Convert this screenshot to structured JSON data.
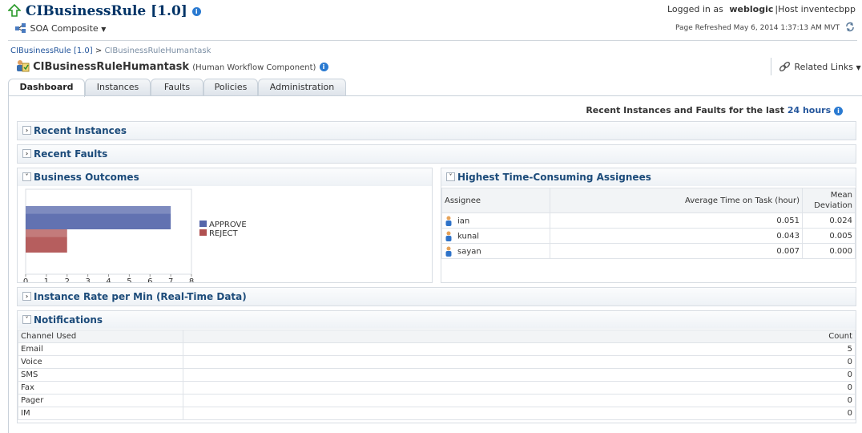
{
  "header": {
    "title": "CIBusinessRule [1.0]",
    "menu": "SOA Composite",
    "logged_in_label": "Logged in as",
    "user": "weblogic",
    "host": "Host inventecbpp",
    "refreshed": "Page Refreshed May 6, 2014 1:37:13 AM MVT"
  },
  "breadcrumb": {
    "root": "CIBusinessRule [1.0]",
    "sep": ">",
    "current": "CIBusinessRuleHumantask"
  },
  "component": {
    "name": "CIBusinessRuleHumantask",
    "type": "(Human Workflow Component)",
    "related_links": "Related Links"
  },
  "tabs": [
    "Dashboard",
    "Instances",
    "Faults",
    "Policies",
    "Administration"
  ],
  "recent_label": "Recent Instances and Faults for the last",
  "recent_period": "24 hours",
  "sections": {
    "recent_instances": "Recent Instances",
    "recent_faults": "Recent Faults",
    "business_outcomes": "Business Outcomes",
    "assignees": "Highest Time-Consuming Assignees",
    "instance_rate": "Instance Rate per Min (Real-Time Data)",
    "notifications": "Notifications"
  },
  "chart_data": {
    "type": "bar",
    "orientation": "horizontal",
    "categories": [
      "APPROVE",
      "REJECT"
    ],
    "values": [
      7,
      2
    ],
    "colors": [
      "#5566aa",
      "#b05050"
    ],
    "xlim": [
      0,
      8
    ],
    "xticks": [
      "0",
      "1",
      "2",
      "3",
      "4",
      "5",
      "6",
      "7",
      "8"
    ],
    "legend": "right"
  },
  "assignees": {
    "columns": [
      "Assignee",
      "Average Time on Task (hour)",
      "Mean",
      "Deviation"
    ],
    "rows": [
      {
        "name": "ian",
        "avg": "0.051",
        "dev": "0.024"
      },
      {
        "name": "kunal",
        "avg": "0.043",
        "dev": "0.005"
      },
      {
        "name": "sayan",
        "avg": "0.007",
        "dev": "0.000"
      }
    ]
  },
  "notifications": {
    "columns": [
      "Channel Used",
      "Count"
    ],
    "rows": [
      {
        "channel": "Email",
        "count": "5"
      },
      {
        "channel": "Voice",
        "count": "0"
      },
      {
        "channel": "SMS",
        "count": "0"
      },
      {
        "channel": "Fax",
        "count": "0"
      },
      {
        "channel": "Pager",
        "count": "0"
      },
      {
        "channel": "IM",
        "count": "0"
      }
    ]
  }
}
